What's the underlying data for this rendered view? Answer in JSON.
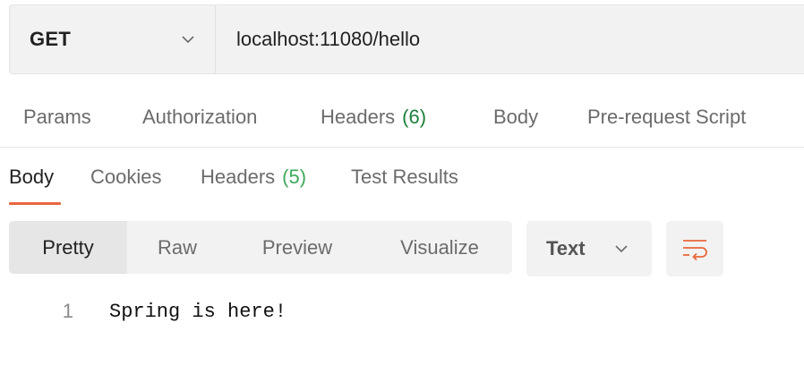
{
  "request": {
    "method": "GET",
    "url": "localhost:11080/hello"
  },
  "request_tabs": [
    {
      "label": "Params",
      "count": ""
    },
    {
      "label": "Authorization",
      "count": ""
    },
    {
      "label": "Headers",
      "count": "(6)"
    },
    {
      "label": "Body",
      "count": ""
    },
    {
      "label": "Pre-request Script",
      "count": ""
    }
  ],
  "response_tabs": [
    {
      "label": "Body",
      "count": "",
      "active": true
    },
    {
      "label": "Cookies",
      "count": ""
    },
    {
      "label": "Headers",
      "count": "(5)"
    },
    {
      "label": "Test Results",
      "count": ""
    }
  ],
  "view_modes": [
    "Pretty",
    "Raw",
    "Preview",
    "Visualize"
  ],
  "active_view": "Pretty",
  "format": {
    "selected": "Text"
  },
  "response_body": {
    "lines": [
      {
        "number": "1",
        "text": "Spring is here!"
      }
    ]
  },
  "colors": {
    "accent": "#e8673c",
    "count_green": "#1d7f3c",
    "count_green_light": "#3fa95b"
  },
  "icons": {
    "method_dropdown": "chevron-down-icon",
    "format_dropdown": "chevron-down-icon",
    "wrap": "wrap-lines-icon"
  }
}
